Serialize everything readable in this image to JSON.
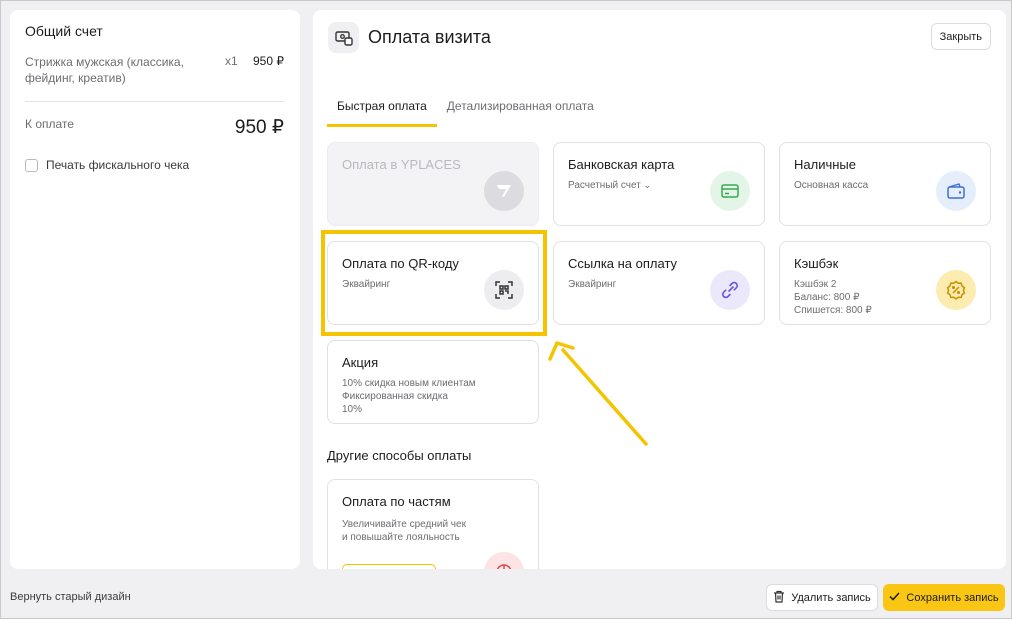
{
  "bill": {
    "title": "Общий счет",
    "service_name": "Стрижка мужская (классика, фейдинг, креатив)",
    "service_qty": "x1",
    "service_price": "950 ₽",
    "due_label": "К оплате",
    "due_value": "950 ₽",
    "fiscal_label": "Печать фискального чека"
  },
  "payment": {
    "title": "Оплата визита",
    "close_label": "Закрыть",
    "tabs": [
      {
        "label": "Быстрая оплата",
        "active": true
      },
      {
        "label": "Детализированная оплата",
        "active": false
      }
    ],
    "methods": [
      {
        "title": "Оплата в YPLACES",
        "disabled": true,
        "icon": "yplaces-logo-icon"
      },
      {
        "title": "Банковская карта",
        "subtitle": "Расчетный счет",
        "has_dropdown": true,
        "icon": "bank-card-icon",
        "icon_bg": "#e3f5e6",
        "icon_color": "#3aa655"
      },
      {
        "title": "Наличные",
        "subtitle": "Основная касса",
        "icon": "wallet-icon",
        "icon_bg": "#e6eefb",
        "icon_color": "#3d6fd6"
      },
      {
        "title": "Оплата по QR-коду",
        "subtitle": "Эквайринг",
        "icon": "qr-code-icon",
        "icon_bg": "#ededf0",
        "icon_color": "#333333"
      },
      {
        "title": "Ссылка на оплату",
        "subtitle": "Эквайринг",
        "icon": "link-icon",
        "icon_bg": "#ebe8fb",
        "icon_color": "#6b55d6"
      },
      {
        "title": "Кэшбэк",
        "subtitle_lines": [
          "Кэшбэк 2",
          "Баланс: 800 ₽",
          "Спишется: 800 ₽"
        ],
        "icon": "cashback-badge-icon",
        "icon_bg": "#fcecb0",
        "icon_color": "#c98f00"
      },
      {
        "title": "Акция",
        "subtitle_lines": [
          "10% скидка новым клиентам",
          "Фиксированная скидка",
          "10%"
        ]
      }
    ],
    "other_title": "Другие способы оплаты",
    "installment": {
      "title": "Оплата по частям",
      "subtitle_lines": [
        "Увеличивайте средний чек",
        "и повышайте лояльность"
      ],
      "icon": "pie-chart-icon"
    }
  },
  "footer": {
    "back_link": "Вернуть старый дизайн",
    "delete_label": "Удалить запись",
    "save_label": "Сохранить запись"
  },
  "colors": {
    "accent": "#f5c400",
    "save_button": "#f8c613",
    "highlight": "#f5c400"
  }
}
